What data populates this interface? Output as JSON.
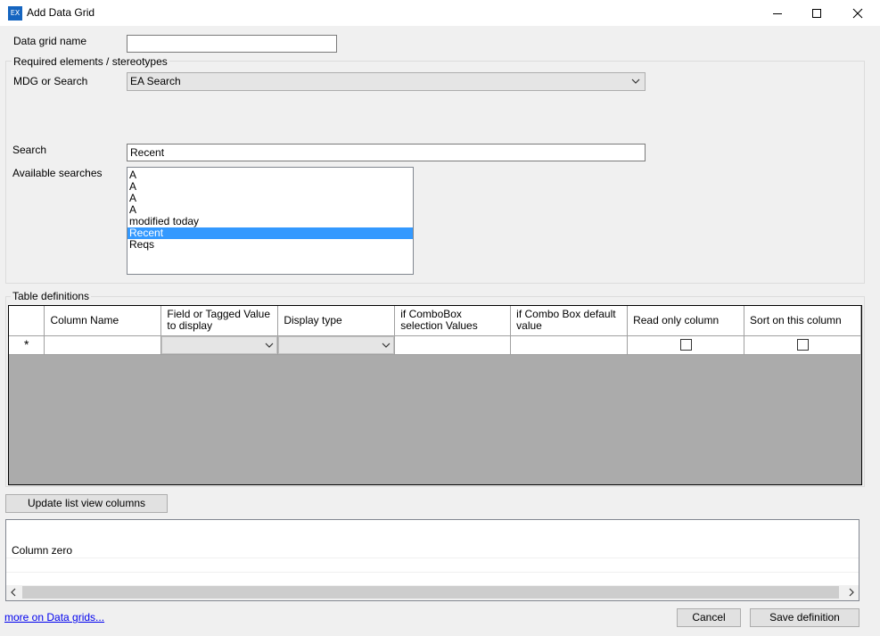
{
  "window": {
    "icon_text": "EX",
    "title": "Add Data Grid"
  },
  "form": {
    "grid_name_label": "Data grid name",
    "grid_name_value": "",
    "required_group_title": "Required elements / stereotypes",
    "mdg_label": "MDG or Search",
    "mdg_value": "EA Search",
    "search_label": "Search",
    "search_value": "Recent",
    "available_label": "Available searches",
    "available_items": [
      "A",
      "A",
      "A",
      "A",
      "modified today",
      "Recent",
      "Reqs"
    ],
    "selected_item": "Recent"
  },
  "table": {
    "group_title": "Table definitions",
    "new_row_marker": "*",
    "columns": [
      "Column Name",
      "Field or Tagged Value to display",
      "Display type",
      "if ComboBox selection Values",
      "if Combo Box default value",
      "Read only column",
      "Sort on this column"
    ]
  },
  "buttons": {
    "update": "Update list view columns",
    "cancel": "Cancel",
    "save": "Save definition"
  },
  "preview": {
    "column_zero": "Column zero"
  },
  "footer": {
    "link": "more on Data grids..."
  },
  "colors": {
    "selection": "#3399ff",
    "link": "#0000ee",
    "grid_background": "#ababab"
  }
}
